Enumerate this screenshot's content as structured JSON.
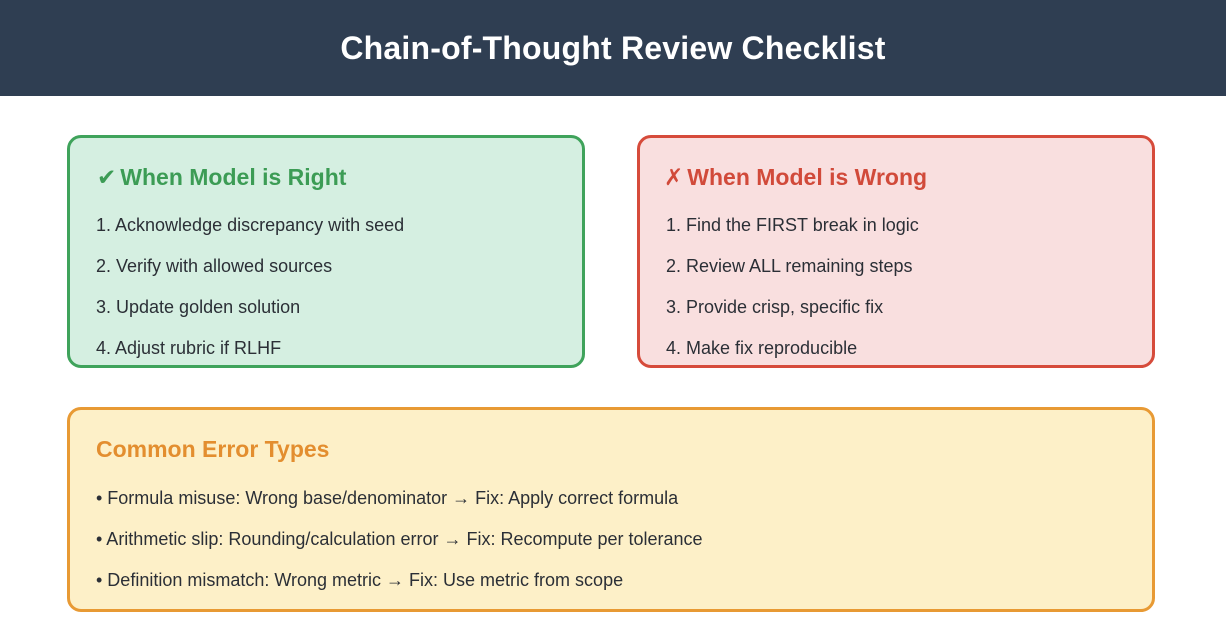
{
  "header": {
    "title": "Chain-of-Thought Review Checklist"
  },
  "right_card": {
    "icon": "✔",
    "icon_name": "check-icon",
    "title": "When Model is Right",
    "accent": "#3fa35b",
    "items": [
      "1. Acknowledge discrepancy with seed",
      "2. Verify with allowed sources",
      "3. Update golden solution",
      "4. Adjust rubric if RLHF"
    ]
  },
  "wrong_card": {
    "icon": "✗",
    "icon_name": "cross-icon",
    "title": "When Model is Wrong",
    "accent": "#d64b3b",
    "items": [
      "1. Find the FIRST break in logic",
      "2. Review ALL remaining steps",
      "3. Provide crisp, specific fix",
      "4. Make fix reproducible"
    ]
  },
  "errors_card": {
    "title": "Common Error Types",
    "accent": "#e89a34",
    "items": [
      "• Formula misuse: Wrong base/denominator → Fix: Apply correct formula",
      "• Arithmetic slip: Rounding/calculation error → Fix: Recompute per tolerance",
      "• Definition mismatch: Wrong metric → Fix: Use metric from scope"
    ]
  }
}
